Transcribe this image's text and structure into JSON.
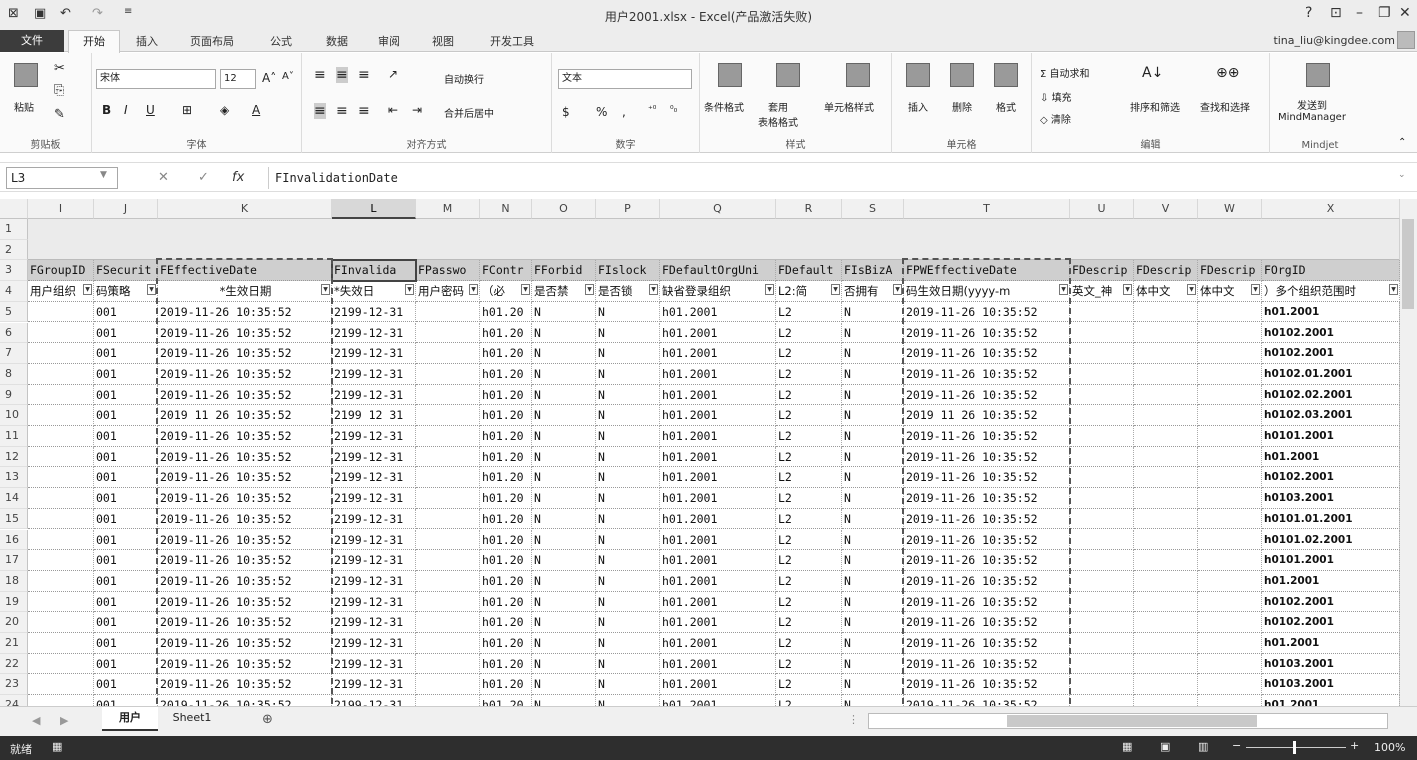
{
  "title_bar": {
    "title": "用户2001.xlsx - Excel(产品激活失败)",
    "help": "?",
    "min": "–",
    "restore": "❐",
    "close": "✕",
    "ribbon_display": "⊡"
  },
  "tabs": [
    "文件",
    "开始",
    "插入",
    "页面布局",
    "公式",
    "数据",
    "审阅",
    "视图",
    "开发工具"
  ],
  "account": "tina_liu@kingdee.com",
  "ribbon": {
    "clipboard": {
      "paste": "粘贴",
      "label": "剪贴板"
    },
    "font": {
      "name": "宋体",
      "size": "12",
      "bold": "B",
      "italic": "I",
      "underline": "U",
      "grow": "A˄",
      "shrink": "A˅",
      "label": "字体"
    },
    "alignment": {
      "wrap": "自动换行",
      "merge": "合并后居中",
      "label": "对齐方式"
    },
    "number": {
      "format": "文本",
      "currency": "$",
      "percent": "%",
      "comma": ",",
      "label": "数字"
    },
    "styles": {
      "conditional": "条件格式",
      "table": "套用\n表格格式",
      "cell": "单元格样式",
      "label": "样式"
    },
    "cells": {
      "insert": "插入",
      "delete": "删除",
      "format": "格式",
      "label": "单元格"
    },
    "editing": {
      "autosum": "自动求和",
      "fill": "填充",
      "clear": "清除",
      "sort": "排序和筛选",
      "find": "查找和选择",
      "label": "编辑"
    },
    "mindjet": {
      "send": "发送到\nMindManager",
      "label": "Mindjet"
    }
  },
  "formula_bar": {
    "name_box": "L3",
    "cancel": "✕",
    "enter": "✓",
    "fx": "fx",
    "value": "FInvalidationDate"
  },
  "columns": [
    "I",
    "J",
    "K",
    "L",
    "M",
    "N",
    "O",
    "P",
    "Q",
    "R",
    "S",
    "T",
    "U",
    "V",
    "W",
    "X"
  ],
  "row3": [
    "FGroupID",
    "FSecurit",
    "FEffectiveDate",
    "FInvalida",
    "FPasswo",
    "FContr",
    "FForbid",
    "FIslock",
    "FDefaultOrgUni",
    "FDefault",
    "FIsBizA",
    "FPWEffectiveDate",
    "FDescrip",
    "FDescrip",
    "FDescrip",
    "FOrgID"
  ],
  "row4": [
    "用户组织",
    "码策略",
    "*生效日期",
    "*失效日",
    "用户密码",
    "（必",
    "是否禁",
    "是否锁",
    "缺省登录组织",
    "L2:简",
    "否拥有",
    "码生效日期(yyyy-m",
    "英文_神",
    "体中文",
    "体中文",
    "）多个组织范围时"
  ],
  "rows": [
    {
      "n": "5",
      "j": "001",
      "k": "2019-11-26 10:35:52",
      "l": "2199-12-31",
      "n_": "h01.20",
      "o": "N",
      "p": "N",
      "q": "h01.2001",
      "r": "L2",
      "s": "N",
      "t": "2019-11-26 10:35:52",
      "x": "h01.2001"
    },
    {
      "n": "6",
      "j": "001",
      "k": "2019-11-26 10:35:52",
      "l": "2199-12-31",
      "n_": "h01.20",
      "o": "N",
      "p": "N",
      "q": "h01.2001",
      "r": "L2",
      "s": "N",
      "t": "2019-11-26 10:35:52",
      "x": "h0102.2001"
    },
    {
      "n": "7",
      "j": "001",
      "k": "2019-11-26 10:35:52",
      "l": "2199-12-31",
      "n_": "h01.20",
      "o": "N",
      "p": "N",
      "q": "h01.2001",
      "r": "L2",
      "s": "N",
      "t": "2019-11-26 10:35:52",
      "x": "h0102.2001"
    },
    {
      "n": "8",
      "j": "001",
      "k": "2019-11-26 10:35:52",
      "l": "2199-12-31",
      "n_": "h01.20",
      "o": "N",
      "p": "N",
      "q": "h01.2001",
      "r": "L2",
      "s": "N",
      "t": "2019-11-26 10:35:52",
      "x": "h0102.01.2001"
    },
    {
      "n": "9",
      "j": "001",
      "k": "2019-11-26 10:35:52",
      "l": "2199-12-31",
      "n_": "h01.20",
      "o": "N",
      "p": "N",
      "q": "h01.2001",
      "r": "L2",
      "s": "N",
      "t": "2019-11-26 10:35:52",
      "x": "h0102.02.2001"
    },
    {
      "n": "10",
      "j": "001",
      "k": "2019 11 26 10:35:52",
      "l": "2199 12 31",
      "n_": "h01.20",
      "o": "N",
      "p": "N",
      "q": "h01.2001",
      "r": "L2",
      "s": "N",
      "t": "2019 11 26 10:35:52",
      "x": "h0102.03.2001"
    },
    {
      "n": "11",
      "j": "001",
      "k": "2019-11-26 10:35:52",
      "l": "2199-12-31",
      "n_": "h01.20",
      "o": "N",
      "p": "N",
      "q": "h01.2001",
      "r": "L2",
      "s": "N",
      "t": "2019-11-26 10:35:52",
      "x": "h0101.2001"
    },
    {
      "n": "12",
      "j": "001",
      "k": "2019-11-26 10:35:52",
      "l": "2199-12-31",
      "n_": "h01.20",
      "o": "N",
      "p": "N",
      "q": "h01.2001",
      "r": "L2",
      "s": "N",
      "t": "2019-11-26 10:35:52",
      "x": "h01.2001"
    },
    {
      "n": "13",
      "j": "001",
      "k": "2019-11-26 10:35:52",
      "l": "2199-12-31",
      "n_": "h01.20",
      "o": "N",
      "p": "N",
      "q": "h01.2001",
      "r": "L2",
      "s": "N",
      "t": "2019-11-26 10:35:52",
      "x": "h0102.2001"
    },
    {
      "n": "14",
      "j": "001",
      "k": "2019-11-26 10:35:52",
      "l": "2199-12-31",
      "n_": "h01.20",
      "o": "N",
      "p": "N",
      "q": "h01.2001",
      "r": "L2",
      "s": "N",
      "t": "2019-11-26 10:35:52",
      "x": "h0103.2001"
    },
    {
      "n": "15",
      "j": "001",
      "k": "2019-11-26 10:35:52",
      "l": "2199-12-31",
      "n_": "h01.20",
      "o": "N",
      "p": "N",
      "q": "h01.2001",
      "r": "L2",
      "s": "N",
      "t": "2019-11-26 10:35:52",
      "x": "h0101.01.2001"
    },
    {
      "n": "16",
      "j": "001",
      "k": "2019-11-26 10:35:52",
      "l": "2199-12-31",
      "n_": "h01.20",
      "o": "N",
      "p": "N",
      "q": "h01.2001",
      "r": "L2",
      "s": "N",
      "t": "2019-11-26 10:35:52",
      "x": "h0101.02.2001"
    },
    {
      "n": "17",
      "j": "001",
      "k": "2019-11-26 10:35:52",
      "l": "2199-12-31",
      "n_": "h01.20",
      "o": "N",
      "p": "N",
      "q": "h01.2001",
      "r": "L2",
      "s": "N",
      "t": "2019-11-26 10:35:52",
      "x": "h0101.2001"
    },
    {
      "n": "18",
      "j": "001",
      "k": "2019-11-26 10:35:52",
      "l": "2199-12-31",
      "n_": "h01.20",
      "o": "N",
      "p": "N",
      "q": "h01.2001",
      "r": "L2",
      "s": "N",
      "t": "2019-11-26 10:35:52",
      "x": "h01.2001"
    },
    {
      "n": "19",
      "j": "001",
      "k": "2019-11-26 10:35:52",
      "l": "2199-12-31",
      "n_": "h01.20",
      "o": "N",
      "p": "N",
      "q": "h01.2001",
      "r": "L2",
      "s": "N",
      "t": "2019-11-26 10:35:52",
      "x": "h0102.2001"
    },
    {
      "n": "20",
      "j": "001",
      "k": "2019-11-26 10:35:52",
      "l": "2199-12-31",
      "n_": "h01.20",
      "o": "N",
      "p": "N",
      "q": "h01.2001",
      "r": "L2",
      "s": "N",
      "t": "2019-11-26 10:35:52",
      "x": "h0102.2001"
    },
    {
      "n": "21",
      "j": "001",
      "k": "2019-11-26 10:35:52",
      "l": "2199-12-31",
      "n_": "h01.20",
      "o": "N",
      "p": "N",
      "q": "h01.2001",
      "r": "L2",
      "s": "N",
      "t": "2019-11-26 10:35:52",
      "x": "h01.2001"
    },
    {
      "n": "22",
      "j": "001",
      "k": "2019-11-26 10:35:52",
      "l": "2199-12-31",
      "n_": "h01.20",
      "o": "N",
      "p": "N",
      "q": "h01.2001",
      "r": "L2",
      "s": "N",
      "t": "2019-11-26 10:35:52",
      "x": "h0103.2001"
    },
    {
      "n": "23",
      "j": "001",
      "k": "2019-11-26 10:35:52",
      "l": "2199-12-31",
      "n_": "h01.20",
      "o": "N",
      "p": "N",
      "q": "h01.2001",
      "r": "L2",
      "s": "N",
      "t": "2019-11-26 10:35:52",
      "x": "h0103.2001"
    },
    {
      "n": "24",
      "j": "001",
      "k": "2019-11-26 10:35:52",
      "l": "2199-12-31",
      "n_": "h01.20",
      "o": "N",
      "p": "N",
      "q": "h01.2001",
      "r": "L2",
      "s": "N",
      "t": "2019-11-26 10:35:52",
      "x": "h01.2001"
    }
  ],
  "sheets": [
    "用户",
    "Sheet1"
  ],
  "status": {
    "ready": "就绪",
    "zoom": "100%"
  }
}
